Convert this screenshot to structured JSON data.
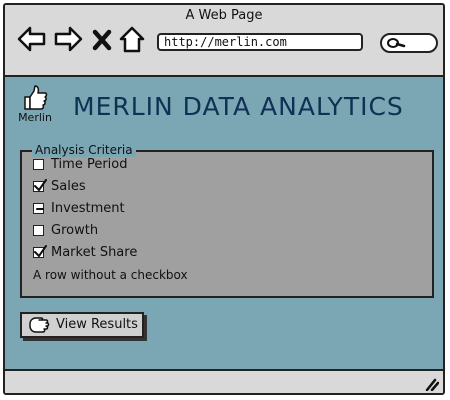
{
  "window": {
    "title": "A Web Page"
  },
  "browser": {
    "url": "http://merlin.com",
    "icons": [
      "back-arrow-icon",
      "forward-arrow-icon",
      "close-x-icon",
      "home-icon",
      "search-icon"
    ]
  },
  "app": {
    "logo_text": "Merlin",
    "logo_icon": "thumbs-up-icon",
    "title": "MERLIN DATA ANALYTICS"
  },
  "criteria": {
    "legend": "Analysis Criteria",
    "items": [
      {
        "label": "Time Period",
        "state": "unchecked"
      },
      {
        "label": "Sales",
        "state": "checked"
      },
      {
        "label": "Investment",
        "state": "indeterminate"
      },
      {
        "label": "Growth",
        "state": "unchecked"
      },
      {
        "label": "Market Share",
        "state": "checked"
      }
    ],
    "plain_row": "A row without a checkbox"
  },
  "actions": {
    "view_results": "View Results",
    "view_results_icon": "hand-pointer-icon"
  },
  "colors": {
    "content_bg": "#7ba6b4",
    "panel_bg": "#a0a0a0",
    "title_color": "#0f3154",
    "chrome_bg": "#d9d9d9"
  }
}
